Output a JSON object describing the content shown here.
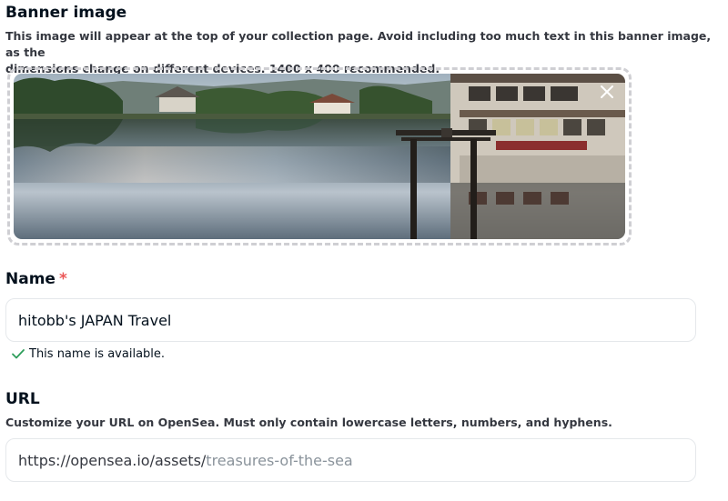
{
  "banner": {
    "title": "Banner image",
    "description_line1": "This image will appear at the top of your collection page. Avoid including too much text in this banner image, as the",
    "description_line2": "dimensions change on different devices. 1400 x 400 recommended.",
    "image_icon": "close-icon"
  },
  "name": {
    "label": "Name",
    "required_mark": "*",
    "value": "hitobb's JAPAN Travel",
    "availability": "This name is available.",
    "availability_icon": "checkmark-icon",
    "success_color": "#2e9e5b"
  },
  "url": {
    "label": "URL",
    "description": "Customize your URL on OpenSea. Must only contain lowercase letters, numbers, and hyphens.",
    "prefix": "https://opensea.io/assets/",
    "placeholder": "treasures-of-the-sea"
  }
}
